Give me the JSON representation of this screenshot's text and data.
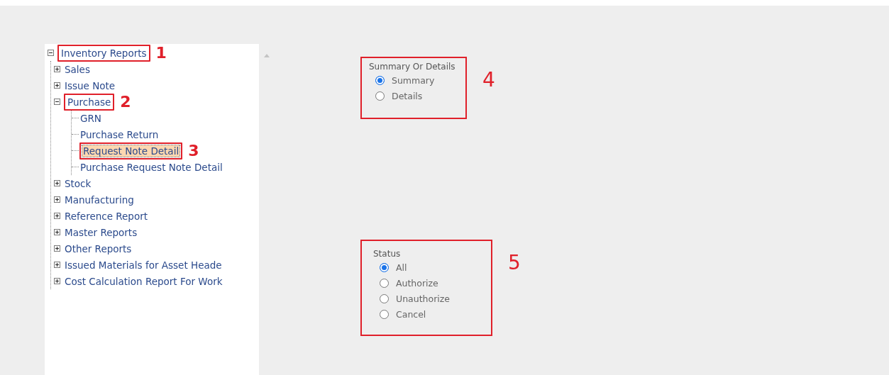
{
  "tree": [
    {
      "label": "Inventory Reports",
      "expanded": true,
      "selected": false,
      "annotation": "1",
      "children": [
        {
          "label": "Sales",
          "expanded": false,
          "selected": false
        },
        {
          "label": "Issue Note",
          "expanded": false,
          "selected": false
        },
        {
          "label": "Purchase",
          "expanded": true,
          "selected": false,
          "annotation": "2",
          "children": [
            {
              "label": "GRN",
              "selected": false
            },
            {
              "label": "Purchase Return",
              "selected": false
            },
            {
              "label": "Request Note Detail",
              "selected": true,
              "annotation": "3"
            },
            {
              "label": "Purchase Request Note Detail",
              "selected": false
            }
          ]
        },
        {
          "label": "Stock",
          "expanded": false,
          "selected": false
        },
        {
          "label": "Manufacturing",
          "expanded": false,
          "selected": false
        },
        {
          "label": "Reference Report",
          "expanded": false,
          "selected": false
        },
        {
          "label": "Master Reports",
          "expanded": false,
          "selected": false
        },
        {
          "label": "Other Reports",
          "expanded": false,
          "selected": false
        },
        {
          "label": "Issued Materials for Asset Heade",
          "expanded": false,
          "selected": false
        },
        {
          "label": "Cost Calculation Report For Work",
          "expanded": false,
          "selected": false
        }
      ]
    }
  ],
  "option_groups": [
    {
      "title": "Summary Or Details",
      "annotation": "4",
      "options": [
        {
          "label": "Summary",
          "selected": true
        },
        {
          "label": "Details",
          "selected": false
        }
      ]
    },
    {
      "title": "Status",
      "annotation": "5",
      "options": [
        {
          "label": "All",
          "selected": true
        },
        {
          "label": "Authorize",
          "selected": false
        },
        {
          "label": "Unauthorize",
          "selected": false
        },
        {
          "label": "Cancel",
          "selected": false
        }
      ]
    }
  ]
}
